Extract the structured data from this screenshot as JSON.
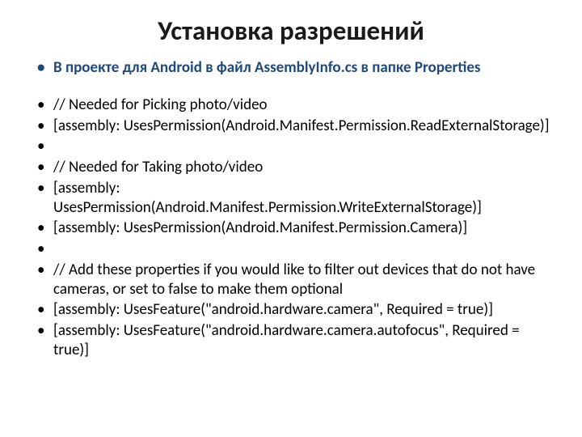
{
  "title": "Установка разрешений",
  "bullets": [
    {
      "text": "В проекте для Android в файл AssemblyInfo.cs в папке Properties",
      "highlight": true
    },
    {
      "text": "// Needed for Picking photo/video"
    },
    {
      "text": "[assembly: UsesPermission(Android.Manifest.Permission.ReadExternalStorage)]"
    },
    {
      "text": ""
    },
    {
      "text": "// Needed for Taking photo/video"
    },
    {
      "text": "[assembly: UsesPermission(Android.Manifest.Permission.WriteExternalStorage)]"
    },
    {
      "text": "[assembly: UsesPermission(Android.Manifest.Permission.Camera)]"
    },
    {
      "text": ""
    },
    {
      "text": "// Add these properties if you would like to filter out devices that do not have cameras, or set to false to make them optional"
    },
    {
      "text": "[assembly: UsesFeature(\"android.hardware.camera\", Required = true)]"
    },
    {
      "text": "[assembly: UsesFeature(\"android.hardware.camera.autofocus\", Required = true)]"
    }
  ]
}
